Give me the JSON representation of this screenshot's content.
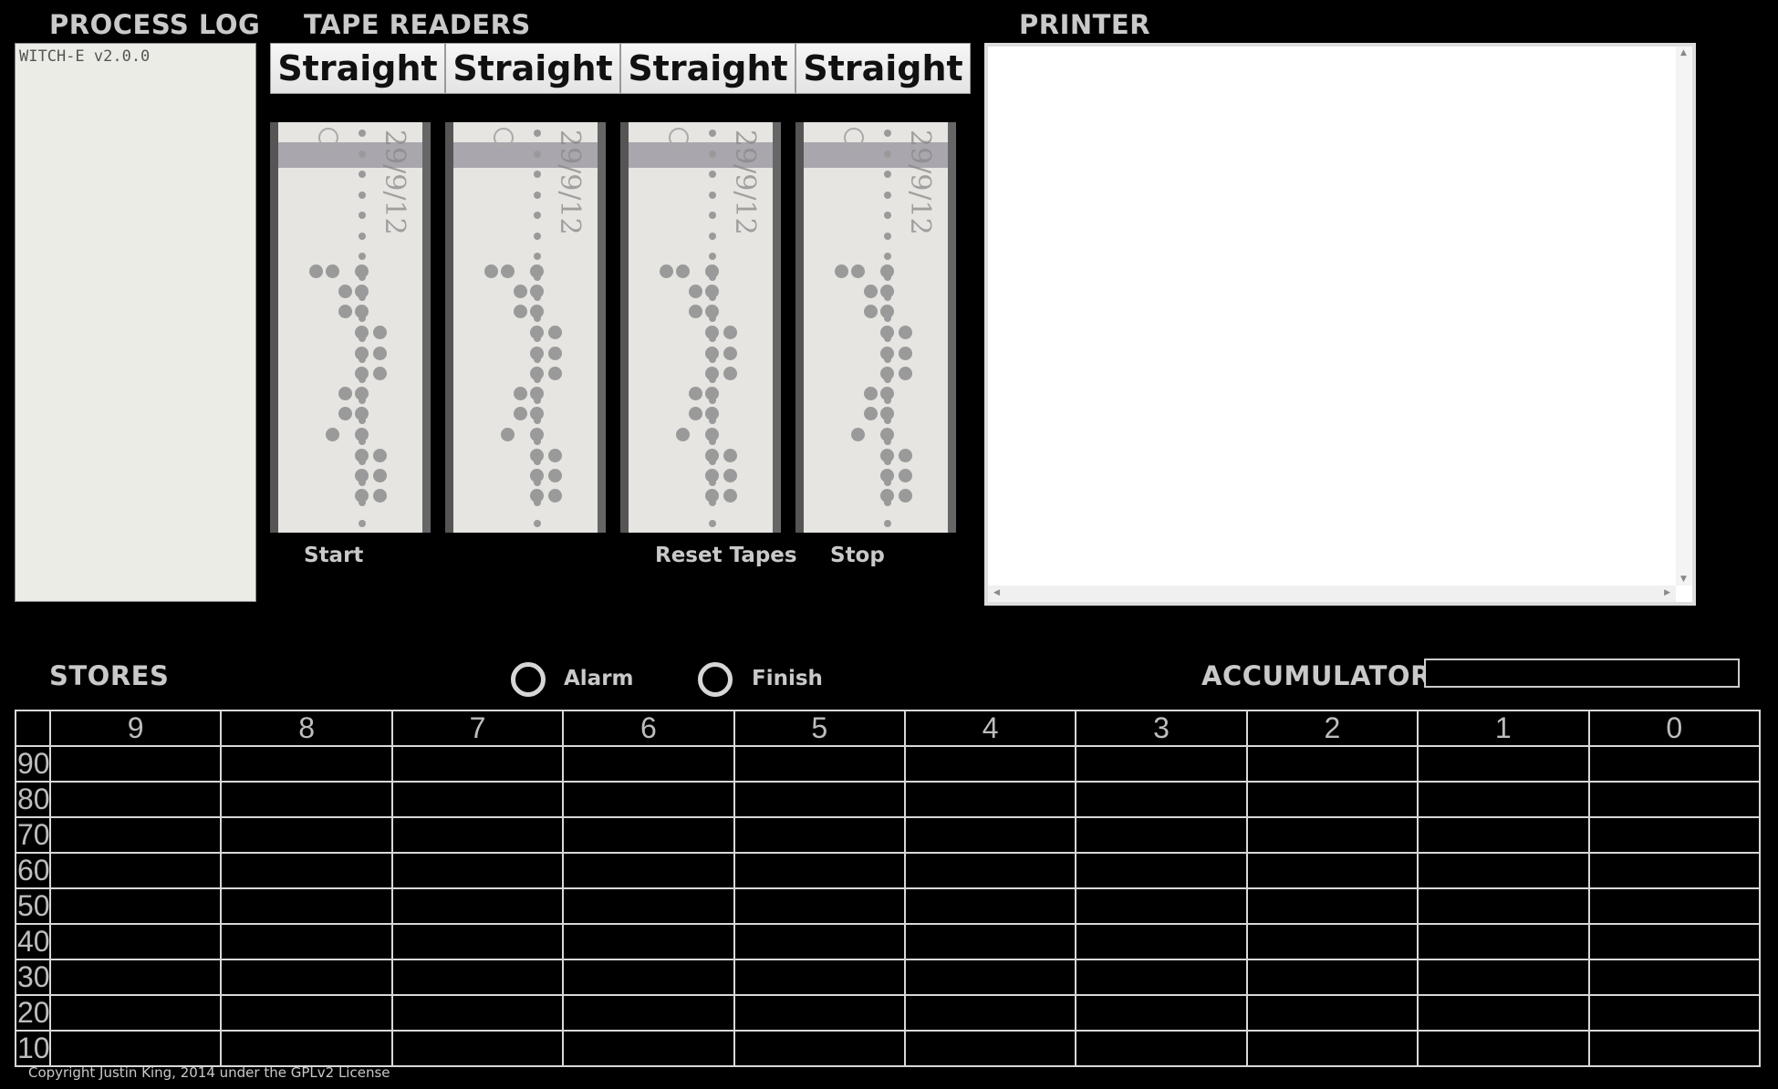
{
  "headings": {
    "process_log": "PROCESS LOG",
    "tape_readers": "TAPE READERS",
    "printer": "PRINTER",
    "stores": "STORES",
    "accumulator": "ACCUMULATOR"
  },
  "process_log": {
    "text": "WITCH-E v2.0.0"
  },
  "tape_readers": {
    "buttons": [
      "Straight",
      "Straight",
      "Straight",
      "Straight"
    ],
    "tape_mark": "29/9/12"
  },
  "controls": {
    "start": "Start",
    "reset_tapes": "Reset Tapes",
    "stop": "Stop"
  },
  "indicators": {
    "alarm": "Alarm",
    "finish": "Finish"
  },
  "accumulator": {
    "value": ""
  },
  "stores": {
    "columns": [
      "9",
      "8",
      "7",
      "6",
      "5",
      "4",
      "3",
      "2",
      "1",
      "0"
    ],
    "rows": [
      "90",
      "80",
      "70",
      "60",
      "50",
      "40",
      "30",
      "20",
      "10"
    ]
  },
  "footer": {
    "copyright": "Copyright Justin King, 2014 under the GPLv2 License"
  },
  "colors": {
    "background": "#000000",
    "heading": "#c9c9c9",
    "log_bg": "#ecece6",
    "tape_paper": "#e6e5e1",
    "tape_band": "#a29ea8"
  }
}
